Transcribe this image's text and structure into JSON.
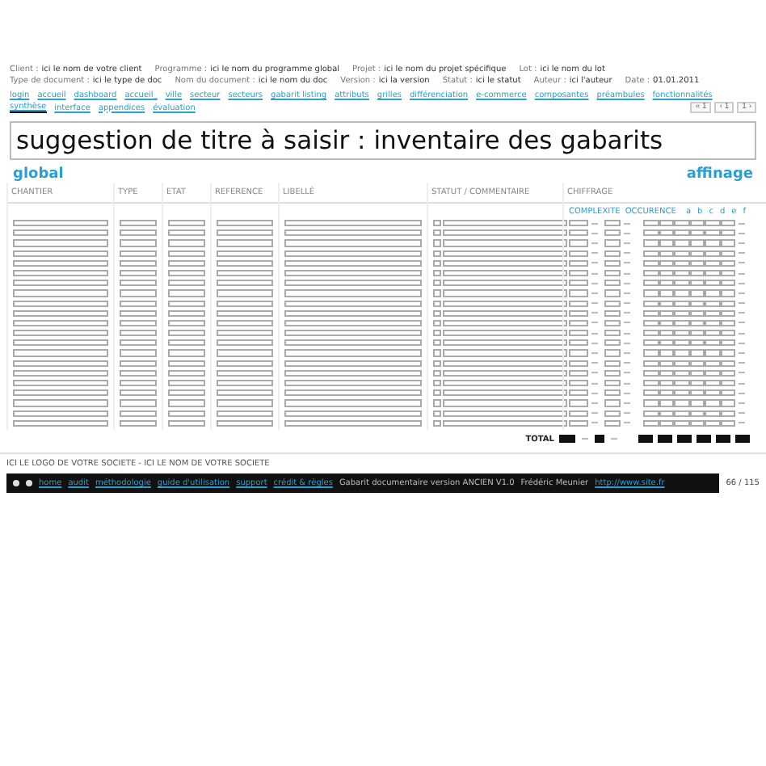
{
  "meta": [
    {
      "label": "Client :",
      "value": "ici le nom de votre client"
    },
    {
      "label": "Programme :",
      "value": "ici le nom du programme global"
    },
    {
      "label": "Projet :",
      "value": "ici le nom du projet spécifique"
    },
    {
      "label": "Lot :",
      "value": "ici le nom du lot"
    },
    {
      "label": "Type de document :",
      "value": "ici le type de doc"
    },
    {
      "label": "Nom du document :",
      "value": "ici le nom du doc"
    },
    {
      "label": "Version :",
      "value": "ici la version"
    },
    {
      "label": "Statut :",
      "value": "ici le statut"
    },
    {
      "label": "Auteur :",
      "value": "ici l'auteur"
    },
    {
      "label": "Date :",
      "value": "01.01.2011"
    }
  ],
  "nav": [
    {
      "label": "login",
      "selected": false
    },
    {
      "label": "accueil",
      "selected": false
    },
    {
      "label": "dashboard",
      "selected": false
    },
    {
      "label": "accueil_",
      "selected": false
    },
    {
      "label": "ville",
      "selected": false
    },
    {
      "label": "secteur",
      "selected": false
    },
    {
      "label": "secteurs",
      "selected": false
    },
    {
      "label": "gabarit listing",
      "selected": false
    },
    {
      "label": "attributs",
      "selected": false
    },
    {
      "label": "grilles",
      "selected": false
    },
    {
      "label": "différenciation",
      "selected": false
    },
    {
      "label": "e-commerce",
      "selected": false
    },
    {
      "label": "composantes",
      "selected": false
    },
    {
      "label": "préambules",
      "selected": false
    },
    {
      "label": "fonctionnalités",
      "selected": false
    },
    {
      "label": "synthèse",
      "selected": true
    },
    {
      "label": "interface",
      "selected": false
    },
    {
      "label": "appendices",
      "selected": false
    },
    {
      "label": "évaluation",
      "selected": false
    }
  ],
  "pager": [
    "« 1",
    "‹ 1",
    "1 ›"
  ],
  "title": "suggestion de titre à saisir : inventaire des gabarits",
  "section_left": "global",
  "section_right": "affinage",
  "columns": [
    "CHANTIER",
    "TYPE",
    "ETAT",
    "REFERENCE",
    "LIBELLÉ",
    "STATUT / COMMENTAIRE",
    "CHIFFRAGE"
  ],
  "chiffrage": {
    "complexity": "COMPLEXITE",
    "occurrence": "OCCURENCE",
    "grades": [
      "a",
      "b",
      "c",
      "d",
      "e",
      "f"
    ]
  },
  "rows": [
    {
      "checked": false
    },
    {
      "checked": false
    },
    {
      "checked": false
    },
    {
      "checked": false
    },
    {
      "checked": false
    },
    {
      "checked": false
    },
    {
      "checked": false
    },
    {
      "checked": false
    },
    {
      "checked": false
    },
    {
      "checked": false
    },
    {
      "checked": false
    },
    {
      "checked": false
    },
    {
      "checked": false
    },
    {
      "checked": false
    },
    {
      "checked": false
    },
    {
      "checked": false
    },
    {
      "checked": false
    },
    {
      "checked": false
    },
    {
      "checked": false
    },
    {
      "checked": false
    },
    {
      "checked": false
    }
  ],
  "total_label": "TOTAL",
  "footer": {
    "company": "ICI LE LOGO DE VOTRE SOCIETE - ICI LE NOM DE VOTRE SOCIETE",
    "links": [
      "home",
      "audit",
      "méthodologie",
      "guide d'utilisation",
      "support",
      "crédit & règles"
    ],
    "version": "Gabarit documentaire version ANCIEN V1.0",
    "author": "Frédéric Meunier",
    "site": "http://www.site.fr",
    "page": "66 / 115"
  }
}
